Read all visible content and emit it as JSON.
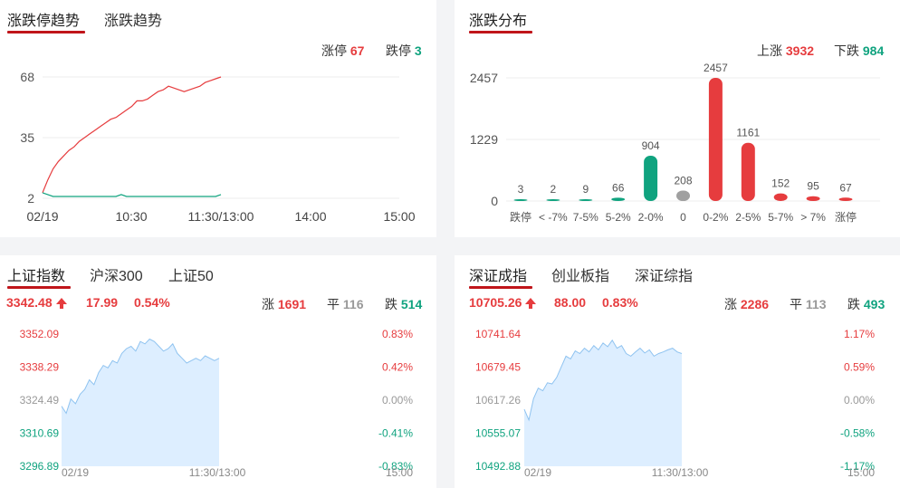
{
  "p1": {
    "tabs": [
      "涨跌停趋势",
      "涨跌趋势"
    ],
    "limit_up_label": "涨停",
    "limit_up": "67",
    "limit_down_label": "跌停",
    "limit_down": "3"
  },
  "p2": {
    "tabs": [
      "涨跌分布"
    ],
    "up_label": "上涨",
    "up": "3932",
    "down_label": "下跌",
    "down": "984"
  },
  "p3": {
    "tabs": [
      "上证指数",
      "沪深300",
      "上证50"
    ],
    "price": "3342.48",
    "change": "17.99",
    "pct": "0.54%",
    "up_label": "涨",
    "up": "1691",
    "flat_label": "平",
    "flat": "116",
    "down_label": "跌",
    "down": "514"
  },
  "p4": {
    "tabs": [
      "深证成指",
      "创业板指",
      "深证综指"
    ],
    "price": "10705.26",
    "change": "88.00",
    "pct": "0.83%",
    "up_label": "涨",
    "up": "2286",
    "flat_label": "平",
    "flat": "113",
    "down_label": "跌",
    "down": "493"
  },
  "colors": {
    "red": "#e63c3e",
    "green": "#10a37f",
    "gray": "#a0a0a0",
    "area": "#ddeeff",
    "area_line": "#8fc3f0"
  },
  "chart_data": [
    {
      "type": "line",
      "yticks": [
        "68",
        "35",
        "2"
      ],
      "ylim": [
        2,
        68
      ],
      "xticks": [
        "02/19",
        "10:30",
        "11:30/13:00",
        "14:00",
        "15:00"
      ],
      "series": [
        {
          "color": "#e63c3e",
          "values": [
            5,
            12,
            18,
            22,
            25,
            28,
            30,
            33,
            35,
            37,
            39,
            41,
            43,
            45,
            46,
            48,
            50,
            52,
            55,
            55,
            56,
            58,
            60,
            61,
            63,
            62,
            61,
            60,
            61,
            62,
            63,
            65,
            66,
            67,
            68
          ]
        },
        {
          "color": "#10a37f",
          "values": [
            5,
            4,
            3,
            3,
            3,
            3,
            3,
            3,
            3,
            3,
            3,
            3,
            3,
            3,
            3,
            4,
            3,
            3,
            3,
            3,
            3,
            3,
            3,
            3,
            3,
            3,
            3,
            3,
            3,
            3,
            3,
            3,
            3,
            3,
            4
          ]
        }
      ]
    },
    {
      "type": "bar",
      "yticks": [
        "2457",
        "1229",
        "0"
      ],
      "ylim": [
        0,
        2457
      ],
      "categories": [
        "跌停",
        "< -7%",
        "7-5%",
        "5-2%",
        "2-0%",
        "0",
        "0-2%",
        "2-5%",
        "5-7%",
        "> 7%",
        "涨停"
      ],
      "values": [
        3,
        2,
        9,
        66,
        904,
        208,
        2457,
        1161,
        152,
        95,
        67
      ],
      "value_labels": [
        "3",
        "2",
        "9",
        "66",
        "904",
        "208",
        "2457",
        "1161",
        "152",
        "95",
        "67"
      ],
      "colors": [
        "#10a37f",
        "#10a37f",
        "#10a37f",
        "#10a37f",
        "#10a37f",
        "#a0a0a0",
        "#e63c3e",
        "#e63c3e",
        "#e63c3e",
        "#e63c3e",
        "#e63c3e"
      ]
    },
    {
      "type": "area",
      "left_ticks": [
        "3352.09",
        "3338.29",
        "3324.49",
        "3310.69",
        "3296.89"
      ],
      "right_ticks": [
        "0.83%",
        "0.42%",
        "0.00%",
        "-0.41%",
        "-0.83%"
      ],
      "ylim": [
        3296.89,
        3352.09
      ],
      "xticks": [
        "02/19",
        "11:30/13:00",
        "15:00"
      ],
      "values": [
        3322,
        3319,
        3325,
        3323,
        3327,
        3329,
        3333,
        3331,
        3336,
        3339,
        3338,
        3341,
        3340,
        3344,
        3346,
        3347,
        3345,
        3349,
        3348,
        3350,
        3349,
        3347,
        3345,
        3346,
        3348,
        3344,
        3342,
        3340,
        3341,
        3342,
        3341,
        3343,
        3342,
        3341,
        3342
      ]
    },
    {
      "type": "area",
      "left_ticks": [
        "10741.64",
        "10679.45",
        "10617.26",
        "10555.07",
        "10492.88"
      ],
      "right_ticks": [
        "1.17%",
        "0.59%",
        "0.00%",
        "-0.58%",
        "-1.17%"
      ],
      "ylim": [
        10492.88,
        10741.64
      ],
      "xticks": [
        "02/19",
        "11:30/13:00",
        "15:00"
      ],
      "values": [
        10600,
        10580,
        10620,
        10640,
        10635,
        10650,
        10648,
        10660,
        10680,
        10700,
        10695,
        10710,
        10705,
        10715,
        10708,
        10720,
        10712,
        10725,
        10718,
        10730,
        10715,
        10720,
        10705,
        10700,
        10708,
        10715,
        10706,
        10712,
        10700,
        10705,
        10708,
        10712,
        10715,
        10708,
        10705
      ]
    }
  ]
}
